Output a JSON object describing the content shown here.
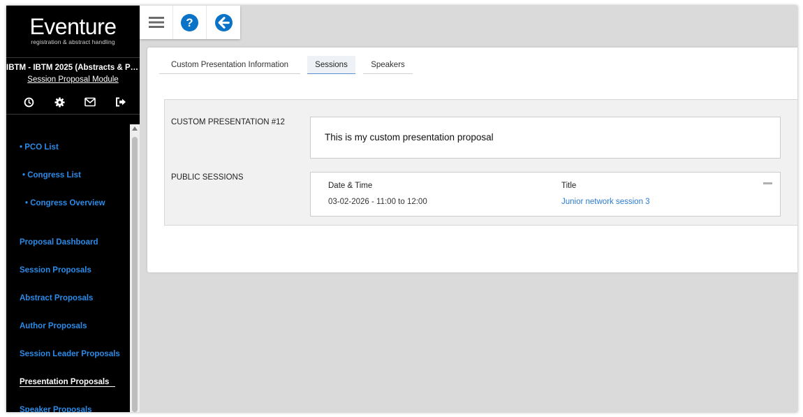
{
  "brand": {
    "name": "Eventure",
    "tagline": "registration & abstract handling"
  },
  "event_title": "IBTM - IBTM 2025 (Abstracts & Par...",
  "module_link": "Session Proposal Module",
  "sidebar_icons": [
    "clock-icon",
    "gear-icon",
    "mail-icon",
    "logout-icon"
  ],
  "nav": {
    "pco_list": "• PCO List",
    "congress_list": "• Congress List",
    "congress_overview": "• Congress Overview",
    "proposal_dashboard": "Proposal Dashboard",
    "session_proposals": "Session Proposals",
    "abstract_proposals": "Abstract Proposals",
    "author_proposals": "Author Proposals",
    "session_leader_proposals": "Session Leader Proposals",
    "presentation_proposals": "Presentation Proposals",
    "speaker_proposals": "Speaker Proposals"
  },
  "toolbar_icons": [
    "menu-icon",
    "help-icon",
    "back-arrow-icon"
  ],
  "tabs": {
    "custom_info": "Custom Presentation Information",
    "sessions": "Sessions",
    "speakers": "Speakers"
  },
  "panel": {
    "presentation_label": "CUSTOM PRESENTATION #12",
    "proposal_text": "This is my custom presentation proposal",
    "public_sessions_label": "PUBLIC SESSIONS"
  },
  "sessions_table": {
    "headers": {
      "datetime": "Date & Time",
      "title": "Title"
    },
    "rows": [
      {
        "datetime": "03-02-2026 - 11:00 to 12:00",
        "title": "Junior network session 3"
      }
    ]
  },
  "colors": {
    "sidebar_bg": "#000000",
    "nav_link": "#2a8be8",
    "toolbar_icon_blue": "#0a73c8",
    "session_link": "#2a7ad0",
    "page_bg": "#dadada"
  }
}
